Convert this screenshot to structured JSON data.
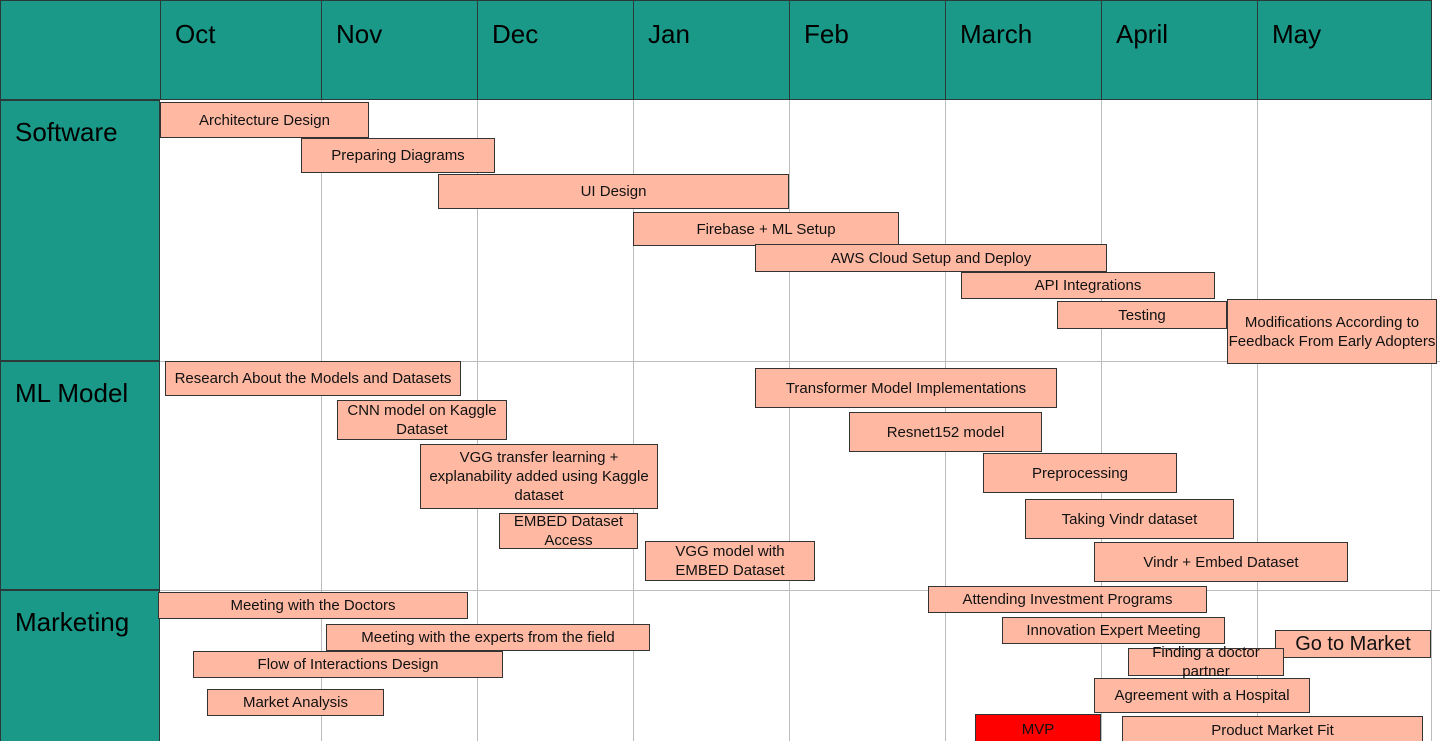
{
  "months": [
    "Oct",
    "Nov",
    "Dec",
    "Jan",
    "Feb",
    "March",
    "April",
    "May"
  ],
  "lanes": [
    "Software",
    "ML Model",
    "Marketing"
  ],
  "colors": {
    "header": "#1a9988",
    "task": "#ffb9a3",
    "milestone": "#ff0000",
    "border": "#333333"
  },
  "tasks": [
    {
      "label": "Architecture Design",
      "lane": "Software"
    },
    {
      "label": "Preparing Diagrams",
      "lane": "Software"
    },
    {
      "label": "UI Design",
      "lane": "Software"
    },
    {
      "label": "Firebase + ML Setup",
      "lane": "Software"
    },
    {
      "label": "AWS Cloud Setup and Deploy",
      "lane": "Software"
    },
    {
      "label": "API Integrations",
      "lane": "Software"
    },
    {
      "label": "Testing",
      "lane": "Software"
    },
    {
      "label": "Modifications According to Feedback From Early Adopters",
      "lane": "Software"
    },
    {
      "label": "Research About the Models and Datasets",
      "lane": "ML Model"
    },
    {
      "label": "CNN model on Kaggle Dataset",
      "lane": "ML Model"
    },
    {
      "label": "VGG transfer learning + explanability added using Kaggle dataset",
      "lane": "ML Model"
    },
    {
      "label": "EMBED Dataset Access",
      "lane": "ML Model"
    },
    {
      "label": "VGG model with EMBED Dataset",
      "lane": "ML Model"
    },
    {
      "label": "Transformer Model Implementations",
      "lane": "ML Model"
    },
    {
      "label": "Resnet152 model",
      "lane": "ML Model"
    },
    {
      "label": "Preprocessing",
      "lane": "ML Model"
    },
    {
      "label": "Taking Vindr dataset",
      "lane": "ML Model"
    },
    {
      "label": "Vindr + Embed Dataset",
      "lane": "ML Model"
    },
    {
      "label": "Meeting with the Doctors",
      "lane": "Marketing"
    },
    {
      "label": "Meeting with the experts from the field",
      "lane": "Marketing"
    },
    {
      "label": "Flow of Interactions Design",
      "lane": "Marketing"
    },
    {
      "label": "Market Analysis",
      "lane": "Marketing"
    },
    {
      "label": "Attending Investment Programs",
      "lane": "Marketing"
    },
    {
      "label": "Innovation Expert Meeting",
      "lane": "Marketing"
    },
    {
      "label": "Go to Market",
      "lane": "Marketing"
    },
    {
      "label": "Finding a doctor partner",
      "lane": "Marketing"
    },
    {
      "label": "Agreement with a Hospital",
      "lane": "Marketing"
    },
    {
      "label": "MVP",
      "lane": "Marketing",
      "milestone": true
    },
    {
      "label": "Product Market Fit",
      "lane": "Marketing"
    }
  ]
}
